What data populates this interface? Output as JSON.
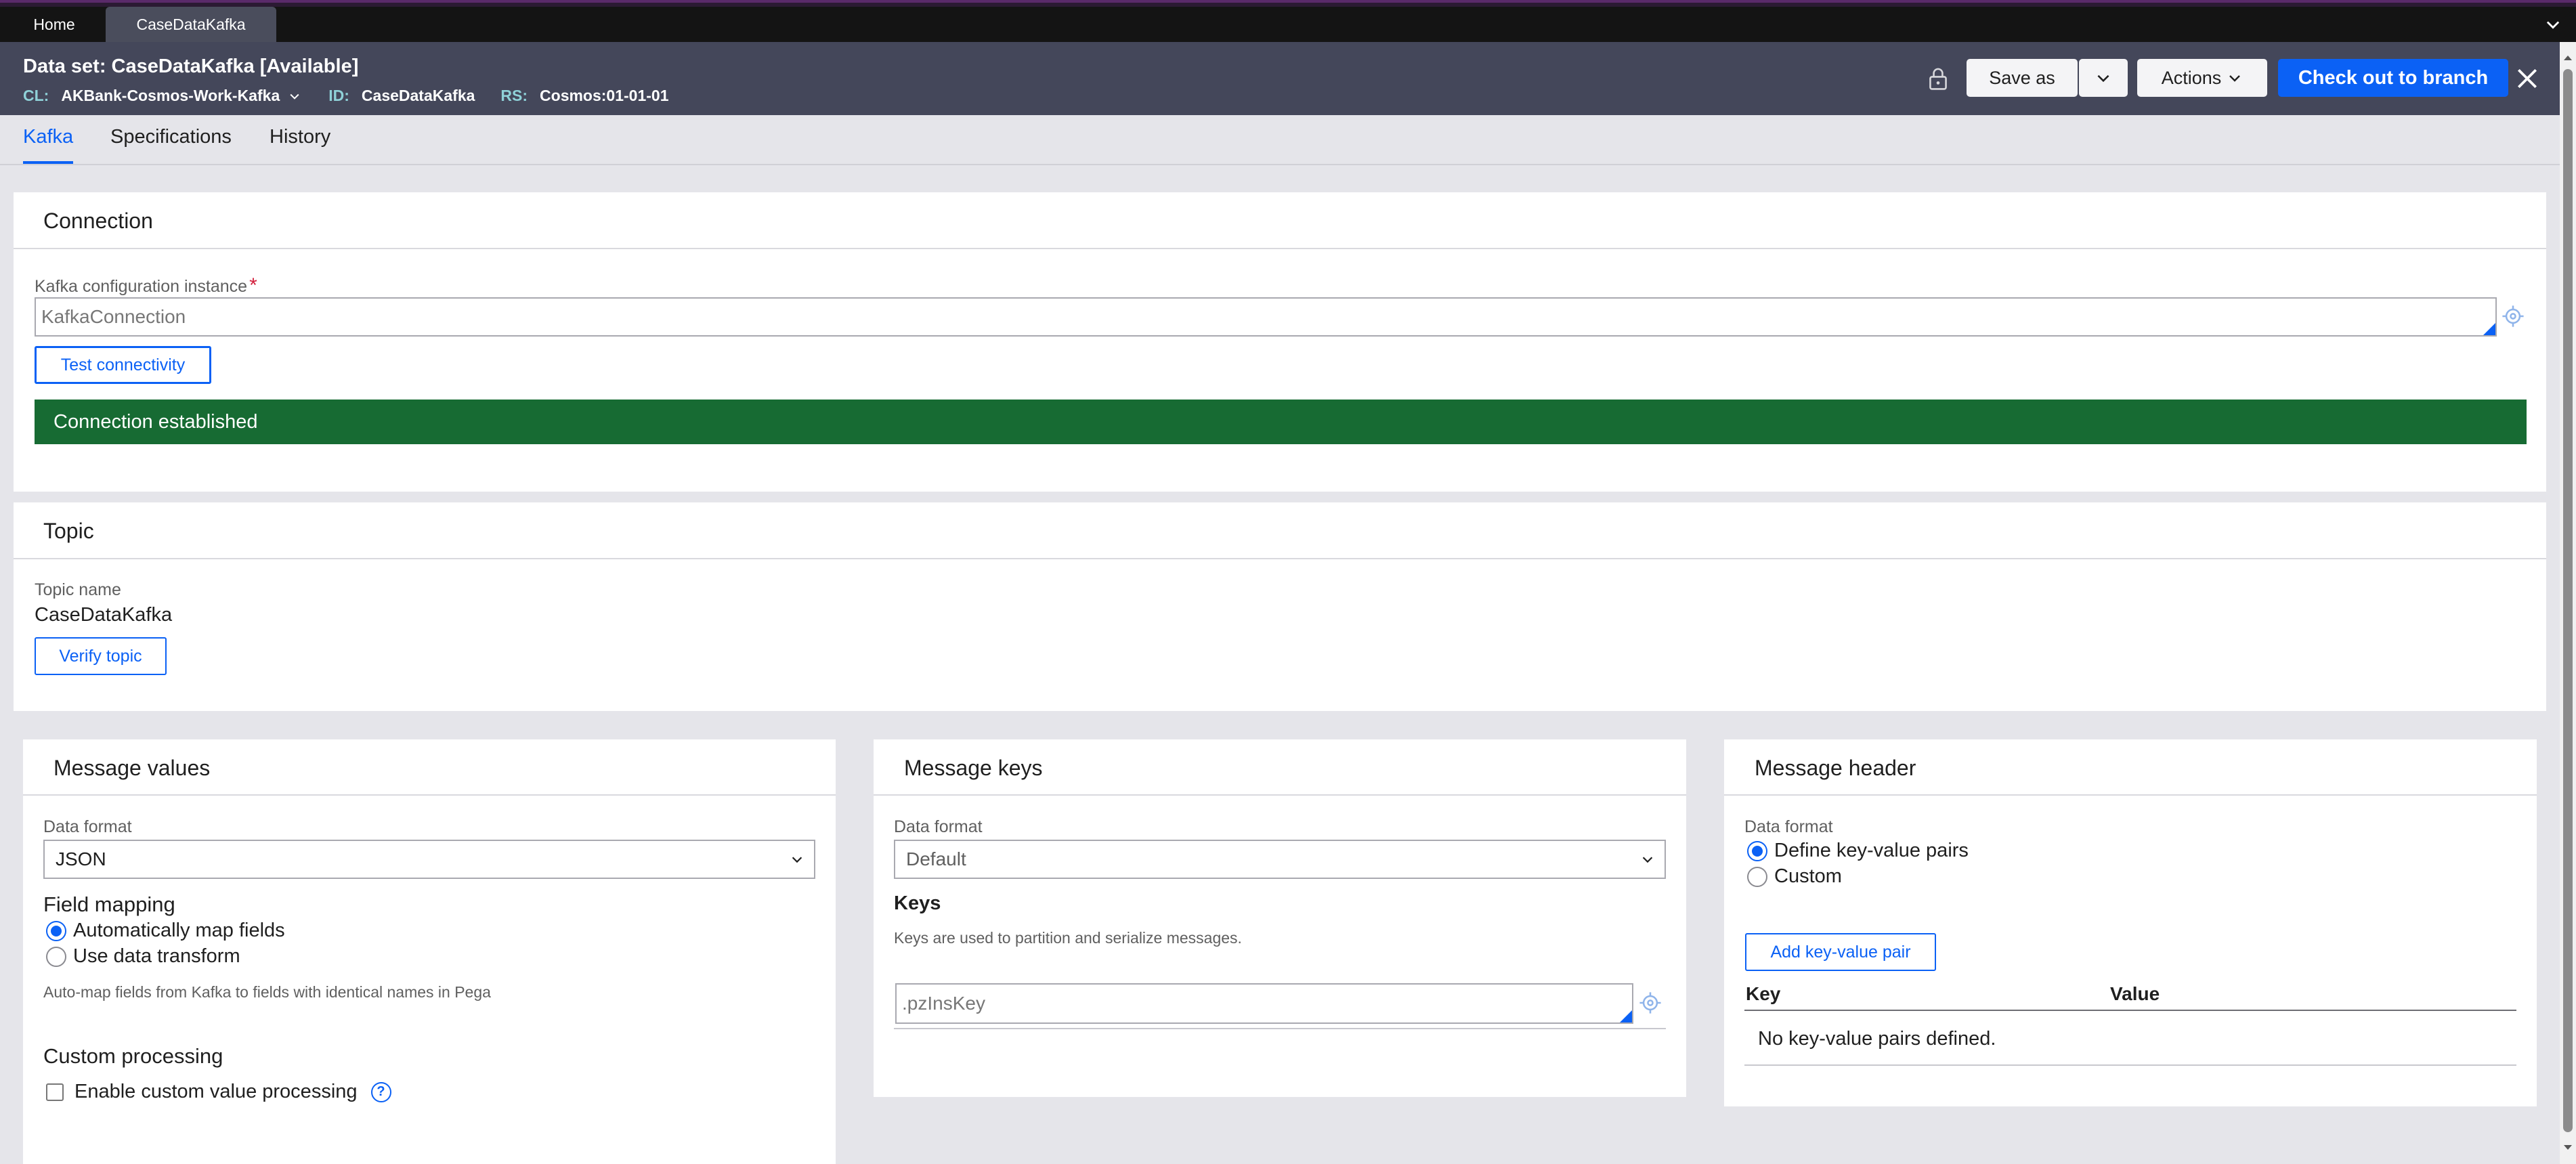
{
  "tabs": {
    "home": "Home",
    "active": "CaseDataKafka"
  },
  "header": {
    "title": "Data set: CaseDataKafka [Available]",
    "cl_label": "CL:",
    "cl_value": "AKBank-Cosmos-Work-Kafka",
    "id_label": "ID:",
    "id_value": "CaseDataKafka",
    "rs_label": "RS:",
    "rs_value": "Cosmos:01-01-01",
    "save_as": "Save as",
    "actions": "Actions",
    "checkout": "Check out to branch"
  },
  "subtabs": [
    "Kafka",
    "Specifications",
    "History"
  ],
  "connection": {
    "title": "Connection",
    "config_label": "Kafka configuration instance",
    "required_mark": "*",
    "config_value": "KafkaConnection",
    "test_button": "Test connectivity",
    "status": "Connection established"
  },
  "topic": {
    "title": "Topic",
    "name_label": "Topic name",
    "name_value": "CaseDataKafka",
    "verify_button": "Verify topic"
  },
  "message_values": {
    "title": "Message values",
    "format_label": "Data format",
    "format_value": "JSON",
    "mapping_heading": "Field mapping",
    "radio_auto": "Automatically map fields",
    "radio_transform": "Use data transform",
    "mapping_help": "Auto-map fields from Kafka to fields with identical names in Pega",
    "custom_heading": "Custom processing",
    "custom_checkbox": "Enable custom value processing",
    "help_glyph": "?"
  },
  "message_keys": {
    "title": "Message keys",
    "format_label": "Data format",
    "format_value": "Default",
    "keys_heading": "Keys",
    "keys_help": "Keys are used to partition and serialize messages.",
    "key_value": ".pzInsKey"
  },
  "message_header": {
    "title": "Message header",
    "format_label": "Data format",
    "radio_define": "Define key-value pairs",
    "radio_custom": "Custom",
    "add_button": "Add key-value pair",
    "col_key": "Key",
    "col_value": "Value",
    "empty": "No key-value pairs defined."
  },
  "colors": {
    "accent": "#0b61f5",
    "success": "#176b33",
    "header_bg": "#44475a",
    "tabbar_bg": "#141414",
    "required": "#d21f3c"
  },
  "icons": [
    "lock-icon",
    "chevron-down-icon",
    "close-icon",
    "target-icon",
    "help-icon"
  ]
}
